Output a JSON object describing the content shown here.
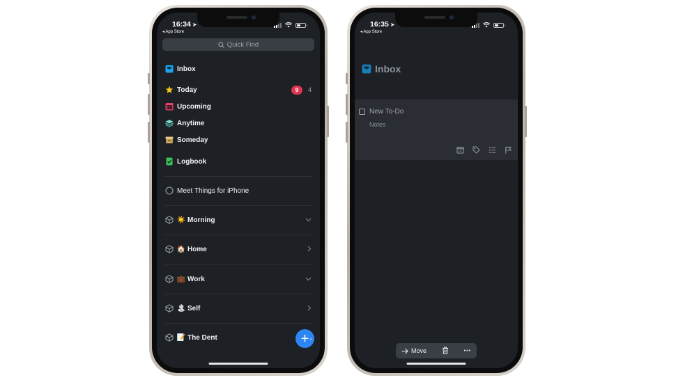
{
  "left_phone": {
    "status": {
      "time": "16:34",
      "back_app": "◂ App Store"
    },
    "search": {
      "placeholder": "Quick Find",
      "icon": "search-icon"
    },
    "lists": [
      {
        "label": "Inbox",
        "icon": "inbox-tray-icon",
        "color": "#1fa0e8"
      },
      {
        "label": "Today",
        "icon": "star-icon",
        "color": "#f5c518",
        "badge": "9",
        "count": "4"
      },
      {
        "label": "Upcoming",
        "icon": "calendar-icon",
        "color": "#e6436b"
      },
      {
        "label": "Anytime",
        "icon": "layers-icon",
        "color": "#5bc2b2"
      },
      {
        "label": "Someday",
        "icon": "archive-box-icon",
        "color": "#d3b06b"
      },
      {
        "label": "Logbook",
        "icon": "logbook-icon",
        "color": "#3cbf5a"
      }
    ],
    "project": {
      "label": "Meet Things for iPhone"
    },
    "areas": [
      {
        "label": "Morning",
        "emoji": "☀️",
        "chevron": "⌄"
      },
      {
        "label": "Home",
        "emoji": "🏠",
        "chevron": "›"
      },
      {
        "label": "Work",
        "emoji": "💼",
        "chevron": "⌄"
      },
      {
        "label": "Self",
        "emoji": "🏝",
        "chevron": "›"
      },
      {
        "label": "The Dent",
        "emoji": "📝"
      }
    ],
    "fab": {
      "icon": "plus-icon",
      "label": "+"
    }
  },
  "right_phone": {
    "status": {
      "time": "16:35",
      "back_app": "◂ App Store"
    },
    "header": {
      "title": "Inbox",
      "icon": "inbox-tray-icon"
    },
    "todo": {
      "title_placeholder": "New To-Do",
      "notes_placeholder": "Notes"
    },
    "card_tools": [
      "calendar-icon",
      "tag-icon",
      "checklist-icon",
      "flag-icon"
    ],
    "toolbar": {
      "move_label": "Move",
      "more_label": "•••"
    }
  },
  "colors": {
    "background": "#1d2025",
    "accent": "#2e86f5",
    "badge": "#e0344f"
  }
}
